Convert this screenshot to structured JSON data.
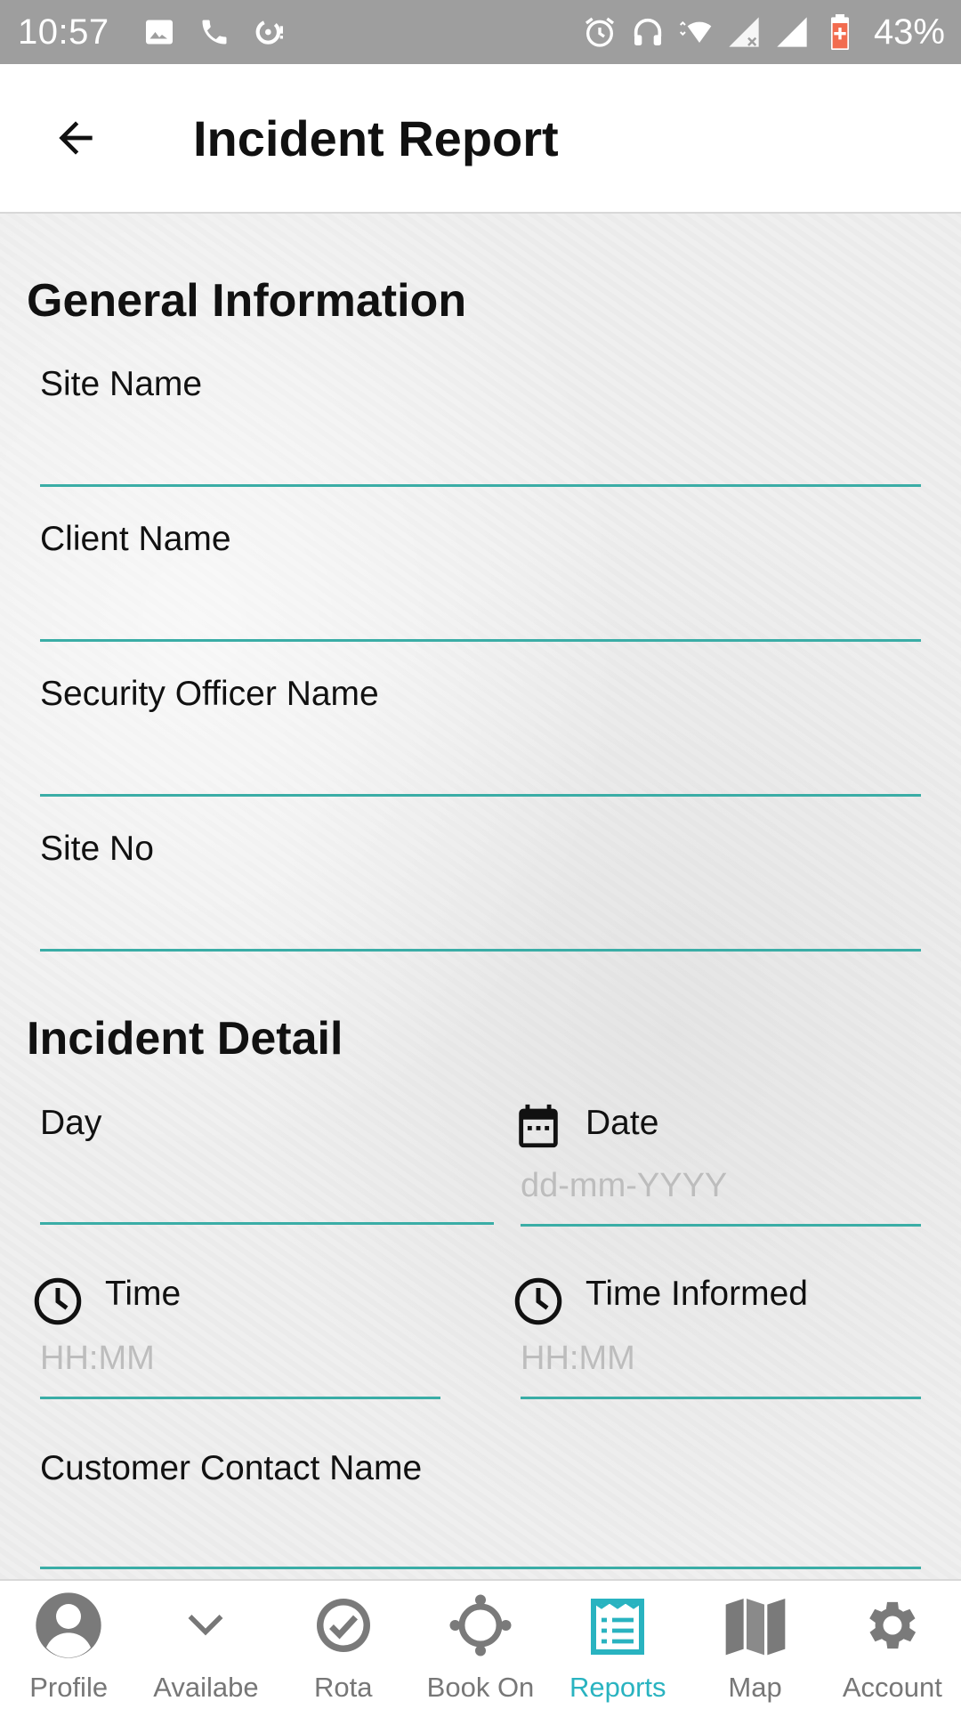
{
  "status_bar": {
    "time": "10:57",
    "battery": "43%"
  },
  "app_bar": {
    "title": "Incident Report"
  },
  "sections": {
    "general": {
      "title": "General Information",
      "site_name": {
        "label": "Site Name",
        "value": ""
      },
      "client_name": {
        "label": "Client Name",
        "value": ""
      },
      "officer_name": {
        "label": "Security Officer Name",
        "value": ""
      },
      "site_no": {
        "label": "Site No",
        "value": ""
      }
    },
    "incident": {
      "title": "Incident Detail",
      "day": {
        "label": "Day",
        "value": ""
      },
      "date": {
        "label": "Date",
        "placeholder": "dd-mm-YYYY"
      },
      "time": {
        "label": "Time",
        "placeholder": "HH:MM"
      },
      "time_informed": {
        "label": "Time Informed",
        "placeholder": "HH:MM"
      },
      "customer_contact": {
        "label": "Customer Contact Name",
        "value": ""
      }
    }
  },
  "bottom_nav": {
    "items": [
      {
        "label": "Profile",
        "icon": "person-icon"
      },
      {
        "label": "Availabe",
        "icon": "chevron-down-icon"
      },
      {
        "label": "Rota",
        "icon": "check-circle-icon"
      },
      {
        "label": "Book On",
        "icon": "crosshair-icon"
      },
      {
        "label": "Reports",
        "icon": "report-icon"
      },
      {
        "label": "Map",
        "icon": "map-icon"
      },
      {
        "label": "Account",
        "icon": "gear-icon"
      }
    ],
    "active": "Reports"
  },
  "colors": {
    "accent": "#3aada6",
    "active_tab": "#29b3c0",
    "status_bar": "#9e9e9e"
  }
}
